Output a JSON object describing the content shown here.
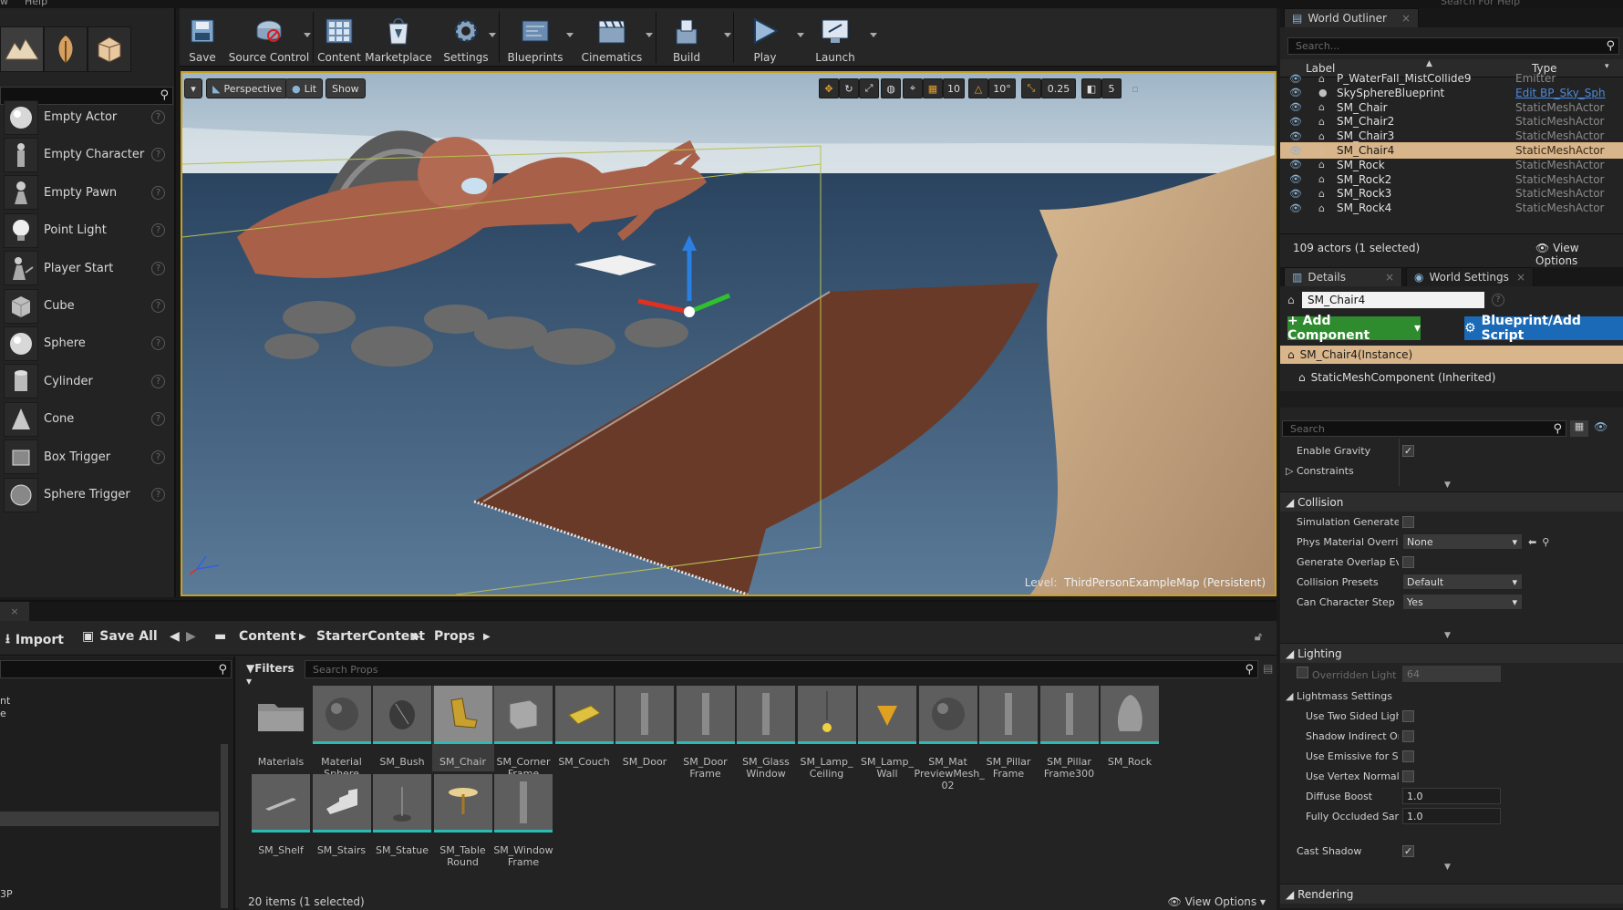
{
  "menubar": {
    "items": [
      "w",
      "Help"
    ]
  },
  "place": {
    "items": [
      {
        "label": "Empty Actor",
        "icon": "sphere-icon"
      },
      {
        "label": "Empty Character",
        "icon": "character-icon"
      },
      {
        "label": "Empty Pawn",
        "icon": "pawn-icon"
      },
      {
        "label": "Point Light",
        "icon": "lightbulb-icon"
      },
      {
        "label": "Player Start",
        "icon": "player-start-icon"
      },
      {
        "label": "Cube",
        "icon": "cube-icon"
      },
      {
        "label": "Sphere",
        "icon": "sphere-icon"
      },
      {
        "label": "Cylinder",
        "icon": "cylinder-icon"
      },
      {
        "label": "Cone",
        "icon": "cone-icon"
      },
      {
        "label": "Box Trigger",
        "icon": "box-trigger-icon"
      },
      {
        "label": "Sphere Trigger",
        "icon": "sphere-trigger-icon"
      }
    ],
    "help": "?"
  },
  "toolbar": {
    "save": "Save",
    "source_control": "Source Control",
    "content": "Content",
    "marketplace": "Marketplace",
    "settings": "Settings",
    "blueprints": "Blueprints",
    "cinematics": "Cinematics",
    "build": "Build",
    "play": "Play",
    "launch": "Launch"
  },
  "viewport": {
    "perspective": "Perspective",
    "lit": "Lit",
    "show": "Show",
    "grid_snap": "10",
    "rotation_snap": "10°",
    "scale_snap": "0.25",
    "camera_speed": "5",
    "level_prefix": "Level:",
    "level_name": "ThirdPersonExampleMap (Persistent)"
  },
  "content_browser": {
    "import": "Import",
    "save_all": "Save All",
    "breadcrumb": [
      "Content",
      "StarterContent",
      "Props"
    ],
    "filters": "Filters",
    "search_placeholder": "Search Props",
    "tree_fragments": [
      "nt",
      "e",
      "3P"
    ],
    "assets": [
      {
        "name": "Materials",
        "kind": "folder"
      },
      {
        "name": "Material Sphere",
        "kind": "sphere"
      },
      {
        "name": "SM_Bush",
        "kind": "bush"
      },
      {
        "name": "SM_Chair",
        "kind": "chair",
        "selected": true
      },
      {
        "name": "SM_Corner Frame",
        "kind": "box"
      },
      {
        "name": "SM_Couch",
        "kind": "couch"
      },
      {
        "name": "SM_Door",
        "kind": "pillar"
      },
      {
        "name": "SM_Door Frame",
        "kind": "pillar"
      },
      {
        "name": "SM_Glass Window",
        "kind": "pillar"
      },
      {
        "name": "SM_Lamp_ Ceiling",
        "kind": "lamp"
      },
      {
        "name": "SM_Lamp_ Wall",
        "kind": "lamp-wall"
      },
      {
        "name": "SM_Mat PreviewMesh_ 02",
        "kind": "sphere"
      },
      {
        "name": "SM_Pillar Frame",
        "kind": "pillar"
      },
      {
        "name": "SM_Pillar Frame300",
        "kind": "pillar"
      },
      {
        "name": "SM_Rock",
        "kind": "rock"
      },
      {
        "name": "SM_Shelf",
        "kind": "shelf"
      },
      {
        "name": "SM_Stairs",
        "kind": "stairs"
      },
      {
        "name": "SM_Statue",
        "kind": "statue"
      },
      {
        "name": "SM_Table Round",
        "kind": "table"
      },
      {
        "name": "SM_Window Frame",
        "kind": "pillar"
      }
    ],
    "status": "20 items (1 selected)",
    "view_options": "View Options"
  },
  "outliner": {
    "tab": "World Outliner",
    "search_placeholder": "Search...",
    "col_label": "Label",
    "col_type": "Type",
    "rows": [
      {
        "label": "P_WaterFall_MistCollide9",
        "type": "Emitter"
      },
      {
        "label": "SkySphereBlueprint",
        "type": "Edit BP_Sky_Sph",
        "link": true
      },
      {
        "label": "SM_Chair",
        "type": "StaticMeshActor"
      },
      {
        "label": "SM_Chair2",
        "type": "StaticMeshActor"
      },
      {
        "label": "SM_Chair3",
        "type": "StaticMeshActor"
      },
      {
        "label": "SM_Chair4",
        "type": "StaticMeshActor",
        "selected": true
      },
      {
        "label": "SM_Rock",
        "type": "StaticMeshActor"
      },
      {
        "label": "SM_Rock2",
        "type": "StaticMeshActor"
      },
      {
        "label": "SM_Rock3",
        "type": "StaticMeshActor"
      },
      {
        "label": "SM_Rock4",
        "type": "StaticMeshActor"
      }
    ],
    "status": "109 actors (1 selected)",
    "view_options": "View Options"
  },
  "details": {
    "tab": "Details",
    "world_settings_tab": "World Settings",
    "name_value": "SM_Chair4",
    "add_component": "+ Add Component",
    "blueprint_script": "Blueprint/Add Script",
    "instance": "SM_Chair4(Instance)",
    "component": "StaticMeshComponent (Inherited)",
    "search_placeholder": "Search",
    "enable_gravity": "Enable Gravity",
    "constraints": "Constraints",
    "collision_title": "Collision",
    "collision_props": [
      {
        "name": "Simulation Generates I",
        "type": "check",
        "value": false
      },
      {
        "name": "Phys Material Overrid",
        "type": "dropdown",
        "value": "None"
      },
      {
        "name": "Generate Overlap Even",
        "type": "check",
        "value": false
      },
      {
        "name": "Collision Presets",
        "type": "dropdown",
        "value": "Default"
      },
      {
        "name": "Can Character Step Up",
        "type": "dropdown",
        "value": "Yes"
      }
    ],
    "lighting_title": "Lighting",
    "overridden_light": "Overridden Light M",
    "overridden_light_value": "64",
    "lightmass_settings": "Lightmass Settings",
    "lighting_props": [
      {
        "name": "Use Two Sided Light",
        "type": "check",
        "value": false
      },
      {
        "name": "Shadow Indirect Only",
        "type": "check",
        "value": false
      },
      {
        "name": "Use Emissive for Sta",
        "type": "check",
        "value": false
      },
      {
        "name": "Use Vertex Normal f",
        "type": "check",
        "value": false
      },
      {
        "name": "Diffuse Boost",
        "type": "number",
        "value": "1.0"
      },
      {
        "name": "Fully Occluded Samp",
        "type": "number",
        "value": "1.0"
      }
    ],
    "cast_shadow": "Cast Shadow",
    "rendering_title": "Rendering",
    "top_search_fragment": "Search For Help"
  }
}
